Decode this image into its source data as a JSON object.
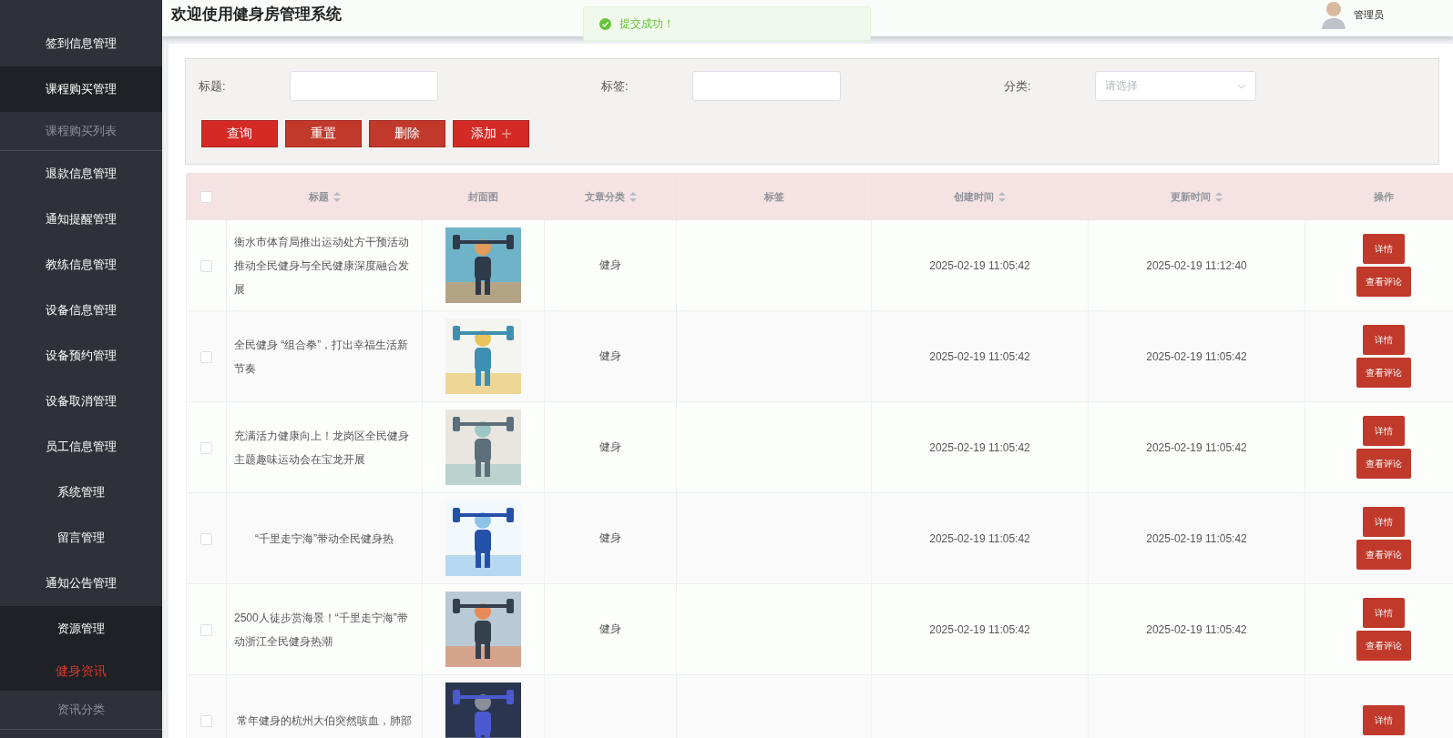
{
  "sidebar": {
    "items": [
      {
        "label": "签到信息管理",
        "kind": "menu",
        "expanded": false,
        "selected": false
      },
      {
        "label": "课程购买管理",
        "kind": "menu",
        "expanded": true,
        "selected": false
      },
      {
        "label": "课程购买列表",
        "kind": "item",
        "selected": false
      },
      {
        "label": "退款信息管理",
        "kind": "menu",
        "expanded": false,
        "selected": false
      },
      {
        "label": "通知提醒管理",
        "kind": "menu",
        "expanded": false,
        "selected": false
      },
      {
        "label": "教练信息管理",
        "kind": "menu",
        "expanded": false,
        "selected": false
      },
      {
        "label": "设备信息管理",
        "kind": "menu",
        "expanded": false,
        "selected": false
      },
      {
        "label": "设备预约管理",
        "kind": "menu",
        "expanded": false,
        "selected": false
      },
      {
        "label": "设备取消管理",
        "kind": "menu",
        "expanded": false,
        "selected": false
      },
      {
        "label": "员工信息管理",
        "kind": "menu",
        "expanded": false,
        "selected": false
      },
      {
        "label": "系统管理",
        "kind": "menu",
        "expanded": false,
        "selected": false
      },
      {
        "label": "留言管理",
        "kind": "menu",
        "expanded": false,
        "selected": false
      },
      {
        "label": "通知公告管理",
        "kind": "menu",
        "expanded": false,
        "selected": false
      },
      {
        "label": "资源管理",
        "kind": "menu",
        "expanded": true,
        "selected": false
      },
      {
        "label": "健身资讯",
        "kind": "submenu",
        "expanded": true,
        "selected": true
      },
      {
        "label": "资讯分类",
        "kind": "item",
        "selected": false
      }
    ]
  },
  "header": {
    "title": "欢迎使用健身房管理系统",
    "user": "管理员"
  },
  "toast": {
    "message": "提交成功！"
  },
  "search": {
    "fields": [
      {
        "label": "标题:",
        "kind": "input"
      },
      {
        "label": "标签:",
        "kind": "input"
      },
      {
        "label": "分类:",
        "kind": "select",
        "placeholder": "请选择"
      }
    ],
    "buttons": [
      {
        "label": "查询",
        "kind": "primary"
      },
      {
        "label": "重置",
        "kind": "plain"
      },
      {
        "label": "删除",
        "kind": "plain"
      },
      {
        "label": "添加",
        "kind": "add"
      }
    ]
  },
  "table": {
    "select_all": {
      "checked": false
    },
    "columns": [
      {
        "label": "标题",
        "sortable": true
      },
      {
        "label": "封面图",
        "sortable": false
      },
      {
        "label": "文章分类",
        "sortable": true
      },
      {
        "label": "标签",
        "sortable": false
      },
      {
        "label": "创建时间",
        "sortable": true
      },
      {
        "label": "更新时间",
        "sortable": true
      },
      {
        "label": "操作",
        "sortable": false
      }
    ],
    "rows": [
      {
        "checked": false,
        "title": "衡水市体育局推出运动处方干预活动推动全民健身与全民健康深度融合发展",
        "cover": {
          "kind": "picture"
        },
        "category": "健身",
        "created": "2025-02-19 11:05:42",
        "updated": "2025-02-19 11:12:40",
        "actions": [
          "详情",
          "查看评论"
        ]
      },
      {
        "checked": false,
        "title": "全民健身 “组合拳”，打出幸福生活新节奏",
        "cover": {
          "kind": "picture"
        },
        "category": "健身",
        "created": "2025-02-19 11:05:42",
        "updated": "2025-02-19 11:05:42",
        "actions": [
          "详情",
          "查看评论"
        ]
      },
      {
        "checked": false,
        "title": "充满活力健康向上！龙岗区全民健身主题趣味运动会在宝龙开展",
        "cover": {
          "kind": "picture"
        },
        "category": "健身",
        "created": "2025-02-19 11:05:42",
        "updated": "2025-02-19 11:05:42",
        "actions": [
          "详情",
          "查看评论"
        ]
      },
      {
        "checked": false,
        "title": "“千里走宁海”带动全民健身热",
        "cover": {
          "kind": "picture"
        },
        "category": "健身",
        "created": "2025-02-19 11:05:42",
        "updated": "2025-02-19 11:05:42",
        "actions": [
          "详情",
          "查看评论"
        ]
      },
      {
        "checked": false,
        "title": "2500人徒步赏海景！“千里走宁海”带动浙江全民健身热潮",
        "cover": {
          "kind": "picture"
        },
        "category": "健身",
        "created": "2025-02-19 11:05:42",
        "updated": "2025-02-19 11:05:42",
        "actions": [
          "详情",
          "查看评论"
        ]
      },
      {
        "checked": false,
        "title": "常年健身的杭州大伯突然咳血，肺部",
        "cover": {
          "kind": "picture"
        },
        "actions": [
          "详情"
        ]
      }
    ]
  }
}
